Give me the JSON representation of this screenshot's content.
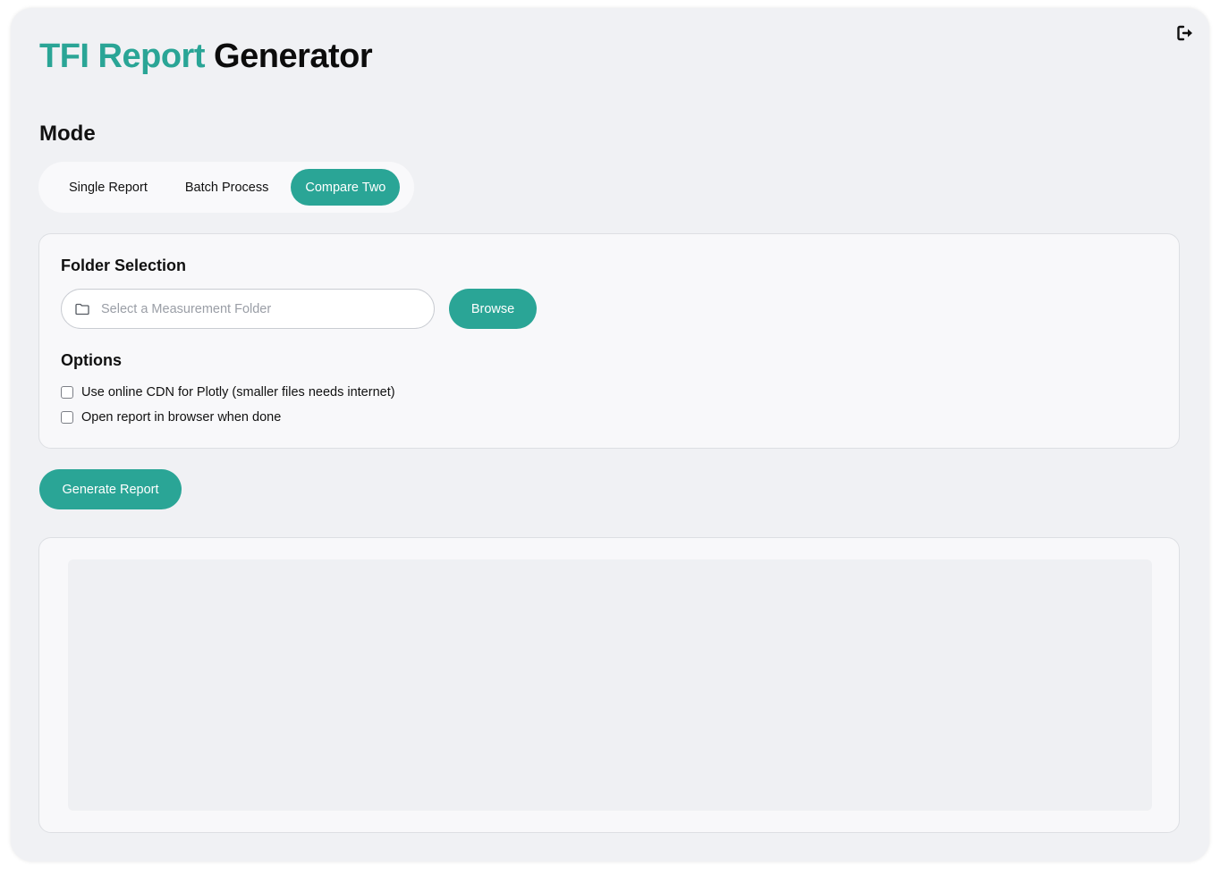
{
  "header": {
    "title_accent": "TFI Report",
    "title_rest": "Generator",
    "logout_icon": "logout-icon"
  },
  "mode": {
    "label": "Mode",
    "options": [
      {
        "label": "Single Report",
        "active": false
      },
      {
        "label": "Batch Process",
        "active": false
      },
      {
        "label": "Compare Two",
        "active": true
      }
    ]
  },
  "folder_selection": {
    "title": "Folder Selection",
    "input_placeholder": "Select a Measurement Folder",
    "input_value": "",
    "folder_icon": "folder-icon",
    "browse_label": "Browse"
  },
  "options": {
    "title": "Options",
    "items": [
      {
        "label": "Use online CDN for Plotly (smaller files needs internet)",
        "checked": false
      },
      {
        "label": "Open report in browser when done",
        "checked": false
      }
    ]
  },
  "actions": {
    "generate_label": "Generate Report"
  },
  "colors": {
    "accent": "#2aa596",
    "background": "#f0f1f4",
    "card": "#f8f8fa"
  }
}
